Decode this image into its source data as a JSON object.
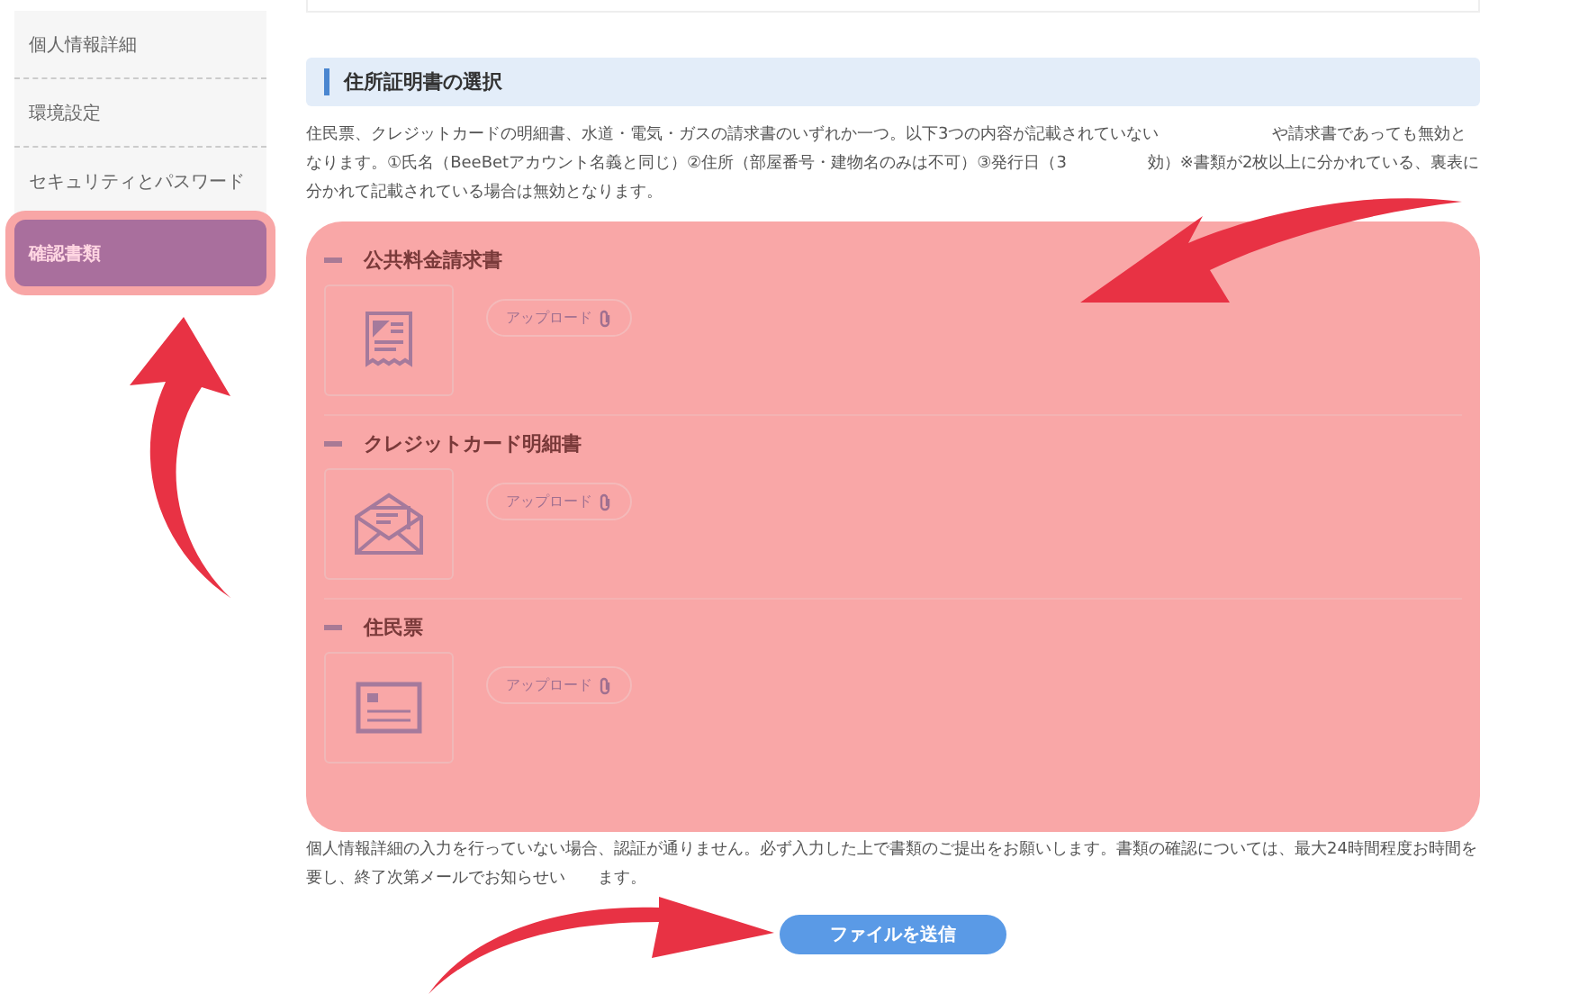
{
  "sidebar": {
    "items": [
      {
        "label": "個人情報詳細",
        "selected": false
      },
      {
        "label": "環境設定",
        "selected": false
      },
      {
        "label": "セキュリティとパスワード",
        "selected": false
      },
      {
        "label": "確認書類",
        "selected": true
      }
    ]
  },
  "section": {
    "title": "住所証明書の選択",
    "description": "住民票、クレジットカードの明細書、水道・電気・ガスの請求書のいずれか一つ。以下3つの内容が記載されていない　　　　　　　や請求書であっても無効となります。①氏名（BeeBetアカウント名義と同じ）②住所（部屋番号・建物名のみは不可）③発行日（3　　　　　効）※書類が2枚以上に分かれている、裏表に分かれて記載されている場合は無効となります。"
  },
  "documents": [
    {
      "kind": "bill",
      "title": "公共料金請求書",
      "upload_label": "アップロード"
    },
    {
      "kind": "envelope",
      "title": "クレジットカード明細書",
      "upload_label": "アップロード"
    },
    {
      "kind": "card",
      "title": "住民票",
      "upload_label": "アップロード"
    }
  ],
  "notice": "個人情報詳細の入力を行っていない場合、認証が通りません。必ず入力した上で書類のご提出をお願いします。書類の確認については、最大24時間程度お時間を要し、終了次第メールでお知らせい　　ます。",
  "submit_button": "ファイルを送信"
}
